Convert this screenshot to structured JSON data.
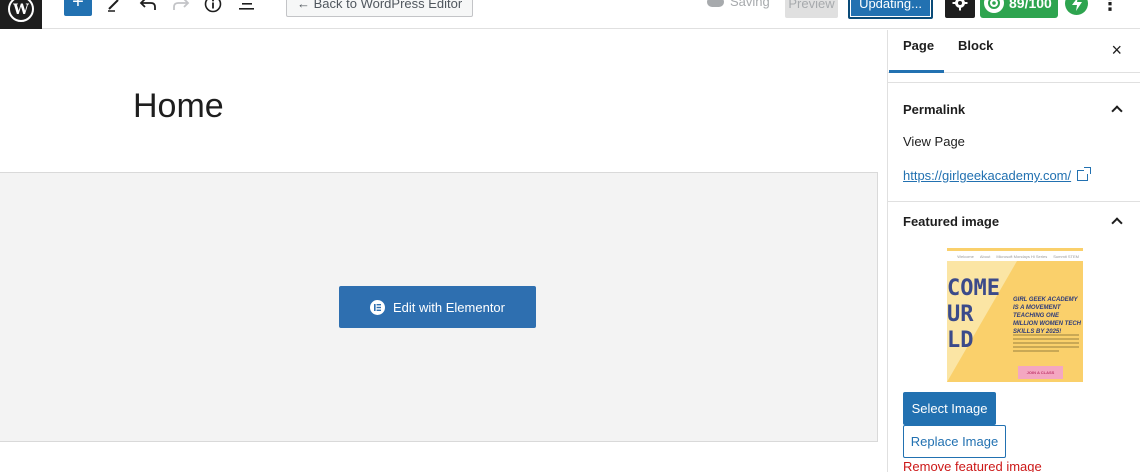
{
  "toolbar": {
    "back_label": "← Back to WordPress Editor",
    "saving_label": "Saving",
    "preview_label": "Preview",
    "updating_label": "Updating...",
    "seo_score": "89/100",
    "perf_label": "A",
    "more_icon": "⋮",
    "brand_color": "#2271b1",
    "seo_color": "#2ea44f"
  },
  "editor": {
    "page_title": "Home",
    "elementor_button": "Edit with Elementor"
  },
  "sidebar": {
    "tabs": [
      {
        "label": "Page",
        "active": true
      },
      {
        "label": "Block",
        "active": false
      }
    ],
    "close_icon": "×",
    "permalink": {
      "heading": "Permalink",
      "view_page": "View Page",
      "url": "https://girlgeekacademy.com/"
    },
    "featured_image": {
      "heading": "Featured image",
      "thumb_nav": [
        "Welcome",
        "About",
        "Microsoft Mondays Hi Series",
        "Summit STEM"
      ],
      "thumb_big": "COME\nUR\nLD",
      "thumb_side": "GIRL GEEK ACADEMY IS A MOVEMENT TEACHING ONE MILLION WOMEN TECH SKILLS BY 2025!",
      "thumb_button": "JOIN A CLASS",
      "select_label": "Select Image",
      "replace_label": "Replace Image",
      "remove_label": "Remove featured image"
    }
  }
}
